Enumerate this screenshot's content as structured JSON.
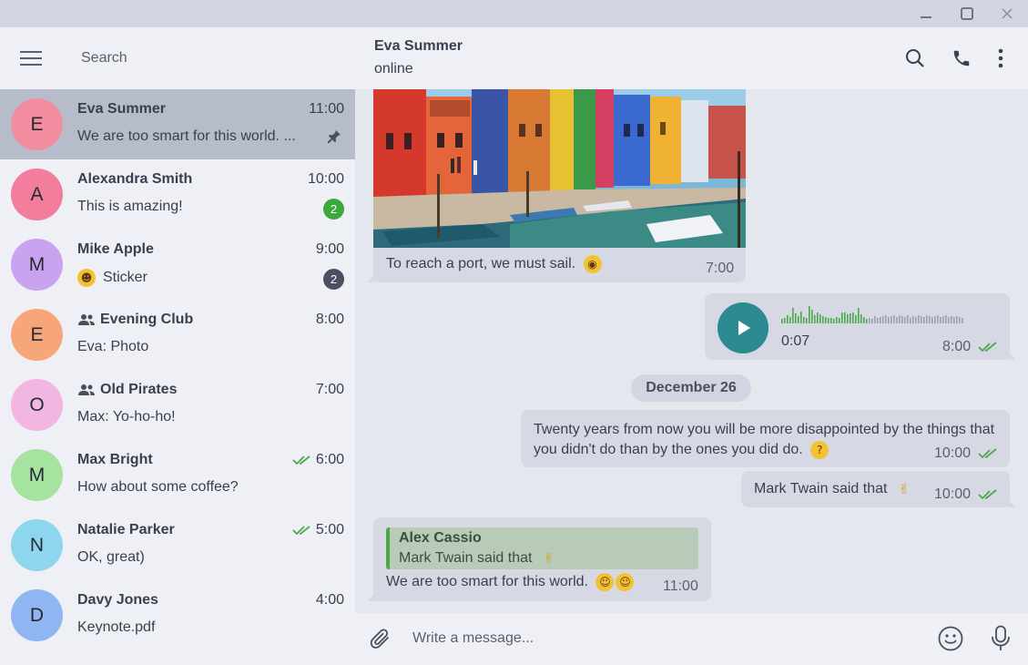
{
  "window": {
    "minimize_icon": "minimize-icon",
    "maximize_icon": "maximize-icon",
    "close_icon": "close-icon"
  },
  "sidebar": {
    "search": {
      "placeholder": "Search"
    },
    "chats": [
      {
        "avatar_letter": "E",
        "avatar_color": "#f28da0",
        "name": "Eva Summer",
        "time": "11:00",
        "preview": "We are too smart for this world. ...",
        "pinned": true,
        "group": false,
        "read": false
      },
      {
        "avatar_letter": "A",
        "avatar_color": "#f27d9c",
        "name": "Alexandra Smith",
        "time": "10:00",
        "preview": "This is amazing!",
        "badge": "2",
        "badge_color": "#3aa83a",
        "group": false,
        "read": false
      },
      {
        "avatar_letter": "M",
        "avatar_color": "#caa3f0",
        "name": "Mike Apple",
        "time": "9:00",
        "preview": "Sticker",
        "preview_emoji": "😄",
        "badge": "2",
        "badge_color": "#4a4f62",
        "group": false,
        "read": false
      },
      {
        "avatar_letter": "E",
        "avatar_color": "#f7a679",
        "name": "Evening Club",
        "time": "8:00",
        "preview": "Eva: Photo",
        "group": true,
        "read": false
      },
      {
        "avatar_letter": "O",
        "avatar_color": "#f2b7e0",
        "name": "Old Pirates",
        "time": "7:00",
        "preview": "Max: Yo-ho-ho!",
        "group": true,
        "read": false
      },
      {
        "avatar_letter": "M",
        "avatar_color": "#a6e3a0",
        "name": "Max Bright",
        "time": "6:00",
        "preview": "How about some coffee?",
        "group": false,
        "read": true
      },
      {
        "avatar_letter": "N",
        "avatar_color": "#8ed6ee",
        "name": "Natalie Parker",
        "time": "5:00",
        "preview": "OK, great)",
        "group": false,
        "read": true
      },
      {
        "avatar_letter": "D",
        "avatar_color": "#8fb6f2",
        "name": "Davy Jones",
        "time": "4:00",
        "preview": "Keynote.pdf",
        "group": false,
        "read": false
      }
    ]
  },
  "header": {
    "peer_name": "Eva Summer",
    "peer_status": "online",
    "search_icon": "search-icon",
    "call_icon": "phone-icon",
    "more_icon": "more-vertical-icon"
  },
  "messages": {
    "photo_caption": "To reach a port, we must sail.",
    "photo_time": "7:00",
    "voice_duration": "0:07",
    "voice_time": "8:00",
    "date_separator": "December 26",
    "quote_text": "Twenty years from now you will be more disappointed by the things that you didn't do than by the ones you did do.",
    "quote_time": "10:00",
    "twain_text": "Mark Twain said that",
    "twain_time": "10:00",
    "reply_author": "Alex Cassio",
    "reply_quoted": "Mark Twain said that",
    "reply_text": "We are too smart for this world.",
    "reply_time": "11:00"
  },
  "composer": {
    "placeholder": "Write a message..."
  },
  "colors": {
    "accent_teal": "#2a8a90",
    "check_green": "#4aaa4a",
    "sidebar_bg": "#eef0f6",
    "active_bg": "#b7bccb"
  }
}
